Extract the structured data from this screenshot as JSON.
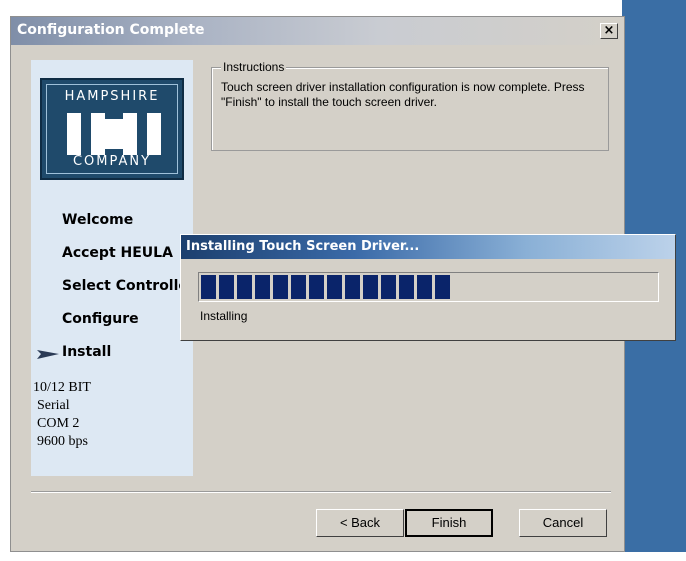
{
  "dialog": {
    "title": "Configuration Complete",
    "close_glyph": "×"
  },
  "logo": {
    "top": "HAMPSHIRE",
    "bottom": "COMPANY"
  },
  "nav": {
    "items": [
      {
        "label": "Welcome"
      },
      {
        "label": "Accept HEULA"
      },
      {
        "label": "Select Controller"
      },
      {
        "label": "Configure"
      },
      {
        "label": "Install",
        "current": true
      }
    ]
  },
  "config_info": [
    "10/12 BIT",
    "Serial",
    "COM 2",
    "9600 bps"
  ],
  "instructions": {
    "legend": "Instructions",
    "text": "Touch screen driver installation configuration is now complete.  Press \"Finish\" to install the touch screen driver."
  },
  "buttons": {
    "back": "< Back",
    "finish": "Finish",
    "cancel": "Cancel"
  },
  "progress": {
    "title": "Installing Touch Screen Driver...",
    "status": "Installing",
    "blocks_filled": 14,
    "blocks_total": 24,
    "bar_color": "#0a246a"
  },
  "colors": {
    "desktop": "#3a6ea5",
    "panel": "#dde8f3",
    "dialog_face": "#d4d0c8"
  },
  "icons": {
    "close": "close-icon",
    "current_step": "arrow-right-icon"
  }
}
